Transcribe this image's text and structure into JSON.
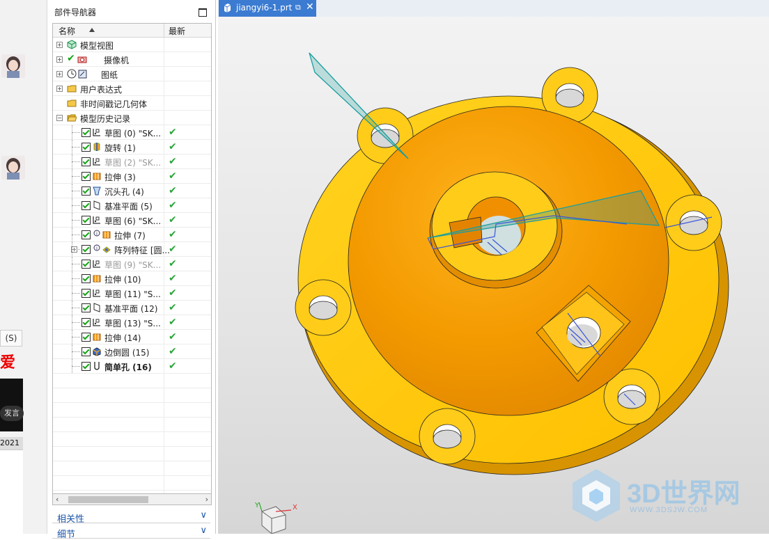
{
  "background_app": {
    "search_button_label": "(S)",
    "ai_text": "爱",
    "speak_button": "发言",
    "date_text": "2021"
  },
  "navigator": {
    "title": "部件导航器",
    "column_name": "名称",
    "column_latest": "最新",
    "rows": [
      {
        "label": "模型视图",
        "icon": "model-views-icon",
        "grey": false
      },
      {
        "label": "摄像机",
        "icon": "camera-icon",
        "grey": false
      },
      {
        "label": "图纸",
        "icon": "drawing-icon",
        "grey": false
      },
      {
        "label": "用户表达式",
        "icon": "folder-icon",
        "grey": false
      },
      {
        "label": "非时间戳记几何体",
        "icon": "folder-icon",
        "grey": false
      },
      {
        "label": "模型历史记录",
        "icon": "folder-open-icon",
        "grey": false
      },
      {
        "label": "草图 (0) \"SK...",
        "icon": "sketch-icon",
        "grey": false,
        "latest": "✔"
      },
      {
        "label": "旋转 (1)",
        "icon": "revolve-icon",
        "grey": false,
        "latest": "✔"
      },
      {
        "label": "草图 (2) \"SK...",
        "icon": "sketch-icon",
        "grey": true,
        "latest": "✔"
      },
      {
        "label": "拉伸 (3)",
        "icon": "extrude-icon",
        "grey": false,
        "latest": "✔"
      },
      {
        "label": "沉头孔 (4)",
        "icon": "counterbore-icon",
        "grey": false,
        "latest": "✔"
      },
      {
        "label": "基准平面 (5)",
        "icon": "datum-plane-icon",
        "grey": false,
        "latest": "✔"
      },
      {
        "label": "草图 (6) \"SK...",
        "icon": "sketch-icon",
        "grey": false,
        "latest": "✔"
      },
      {
        "label": "拉伸 (7)",
        "icon": "extrude-icon",
        "grey": false,
        "latest": "✔"
      },
      {
        "label": "阵列特征 [圆...",
        "icon": "pattern-icon",
        "grey": false,
        "latest": "✔"
      },
      {
        "label": "草图 (9) \"SK...",
        "icon": "sketch-icon",
        "grey": true,
        "latest": "✔"
      },
      {
        "label": "拉伸 (10)",
        "icon": "extrude-icon",
        "grey": false,
        "latest": "✔"
      },
      {
        "label": "草图 (11) \"S...",
        "icon": "sketch-icon",
        "grey": false,
        "latest": "✔"
      },
      {
        "label": "基准平面 (12)",
        "icon": "datum-plane-icon",
        "grey": false,
        "latest": "✔"
      },
      {
        "label": "草图 (13) \"S...",
        "icon": "sketch-icon",
        "grey": false,
        "latest": "✔"
      },
      {
        "label": "拉伸 (14)",
        "icon": "extrude-icon",
        "grey": false,
        "latest": "✔"
      },
      {
        "label": "边倒圆 (15)",
        "icon": "edge-blend-icon",
        "grey": false,
        "latest": "✔"
      },
      {
        "label": "简单孔 (16)",
        "icon": "simple-hole-icon",
        "grey": false,
        "bold": true,
        "latest": "✔"
      }
    ],
    "panel_dependencies": "相关性",
    "panel_details": "细节"
  },
  "graphics": {
    "tab_title": "jiangyi6-1.prt",
    "tab_restore": "⧉",
    "tab_close": "✕",
    "triad_x": "X",
    "triad_y": "Y"
  },
  "watermark": {
    "brand": "3D世界网",
    "url": "WWW.3DSJW.COM"
  },
  "colors": {
    "part_yellow": "#ffcc1a",
    "part_orange": "#f39a00",
    "sketch_teal": "#1a9e9e",
    "sketch_blue": "#3a55d8",
    "check_green": "#2aa53a",
    "tab_blue": "#3b7bd1"
  }
}
